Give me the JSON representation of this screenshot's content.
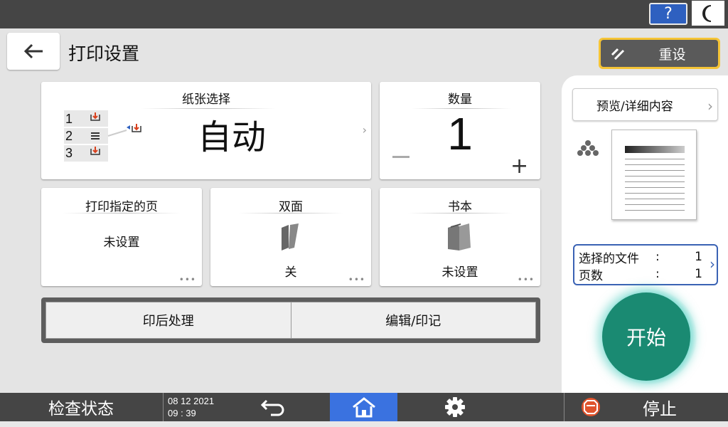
{
  "header": {
    "title": "打印设置",
    "help_label": "?",
    "reset_label": "重设"
  },
  "paper": {
    "title": "纸张选择",
    "value": "自动",
    "trays": [
      "1",
      "2",
      "3"
    ]
  },
  "quantity": {
    "title": "数量",
    "value": "1"
  },
  "specify_pages": {
    "title": "打印指定的页",
    "value": "未设置"
  },
  "duplex": {
    "title": "双面",
    "value": "关"
  },
  "book": {
    "title": "书本",
    "value": "未设置"
  },
  "functions": {
    "post_process": "印后处理",
    "edit_stamp": "编辑/印记"
  },
  "right": {
    "preview_label": "预览/详细内容",
    "files_label": "选择的文件",
    "files_colon": ":",
    "files_value": "1",
    "pages_label": "页数",
    "pages_colon": ":",
    "pages_value": "1",
    "start_label": "开始"
  },
  "bottom": {
    "status_label": "检查状态",
    "date": "08 12 2021",
    "time": "09 : 39",
    "stop_label": "停止"
  },
  "colors": {
    "accent_blue": "#3a72e0",
    "start_green": "#1a8a72",
    "reset_yellow": "#f5c436",
    "bar_dark": "#454545"
  },
  "icons": [
    "help-icon",
    "moon-icon",
    "back-arrow-icon",
    "reset-icon",
    "tray-icon",
    "chevron-right-icon",
    "minus-icon",
    "plus-icon",
    "duplex-icon",
    "book-icon",
    "color-mode-icon",
    "undo-icon",
    "home-icon",
    "gear-icon",
    "stop-icon"
  ]
}
